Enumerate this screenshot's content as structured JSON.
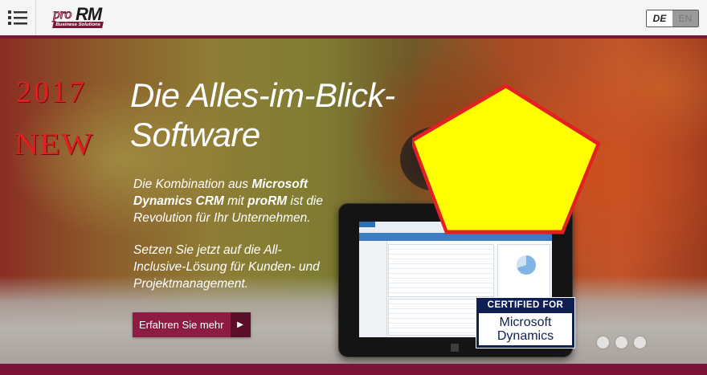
{
  "header": {
    "menu_icon": "list-icon",
    "logo": {
      "pro": "pro",
      "rm": "RM",
      "tagline": "Business Solutions"
    },
    "language": {
      "de": "DE",
      "en": "EN",
      "active": "DE"
    }
  },
  "hero": {
    "badge_year": "2017",
    "badge_new": "NEW",
    "headline_line1": "Die Alles-im-Blick-",
    "headline_line2": "Software",
    "lead": {
      "part1": "Die Kombination aus ",
      "bold1": "Microsoft Dynamics CRM",
      "part2": " mit ",
      "bold2": "proRM",
      "part3": " ist die Revolution für Ihr Unternehmen."
    },
    "lead2": "Setzen Sie jetzt auf die All-Inclusive-Lösung für Kunden- und Projektmanagement.",
    "cta_label": "Erfahren Sie mehr",
    "cta_icon": "play-arrow-icon",
    "certified": {
      "top": "CERTIFIED FOR",
      "line1": "Microsoft",
      "line2": "Dynamics"
    },
    "slider_dots": 3
  },
  "colors": {
    "brand": "#7a1537",
    "cta": "#8d1b44",
    "pentagon_fill": "#ffff00",
    "pentagon_stroke": "#e52020"
  }
}
